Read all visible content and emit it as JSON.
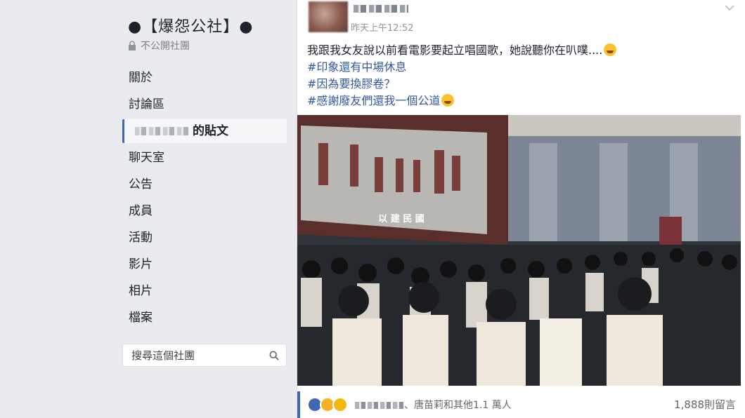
{
  "group": {
    "title": "●【爆怨公社】●",
    "privacy": "不公開社團"
  },
  "sidebar": {
    "items": [
      {
        "label": "關於",
        "active": false
      },
      {
        "label": "討論區",
        "active": false
      },
      {
        "label": "的貼文",
        "active": true
      },
      {
        "label": "聊天室",
        "active": false
      },
      {
        "label": "公告",
        "active": false
      },
      {
        "label": "成員",
        "active": false
      },
      {
        "label": "活動",
        "active": false
      },
      {
        "label": "影片",
        "active": false
      },
      {
        "label": "相片",
        "active": false
      },
      {
        "label": "檔案",
        "active": false
      }
    ],
    "search_placeholder": "搜尋這個社團"
  },
  "post": {
    "timestamp": "昨天上午12:52",
    "text_line1": "我跟我女友說以前看電影要起立唱國歌，她說聽你在叭噗....",
    "hashtag1": "#印象還有中場休息",
    "hashtag2": "#因為要換膠卷？",
    "hashtag3": "#感謝廢友們還我一個公道",
    "screen_caption": "以 建 民 國",
    "reactions_text": "、唐苗莉和其他1.1 萬人",
    "comments_count": "1,888則留言"
  },
  "colors": {
    "accent": "#4267b2",
    "hashtag": "#365899",
    "background": "#e9ebee"
  }
}
